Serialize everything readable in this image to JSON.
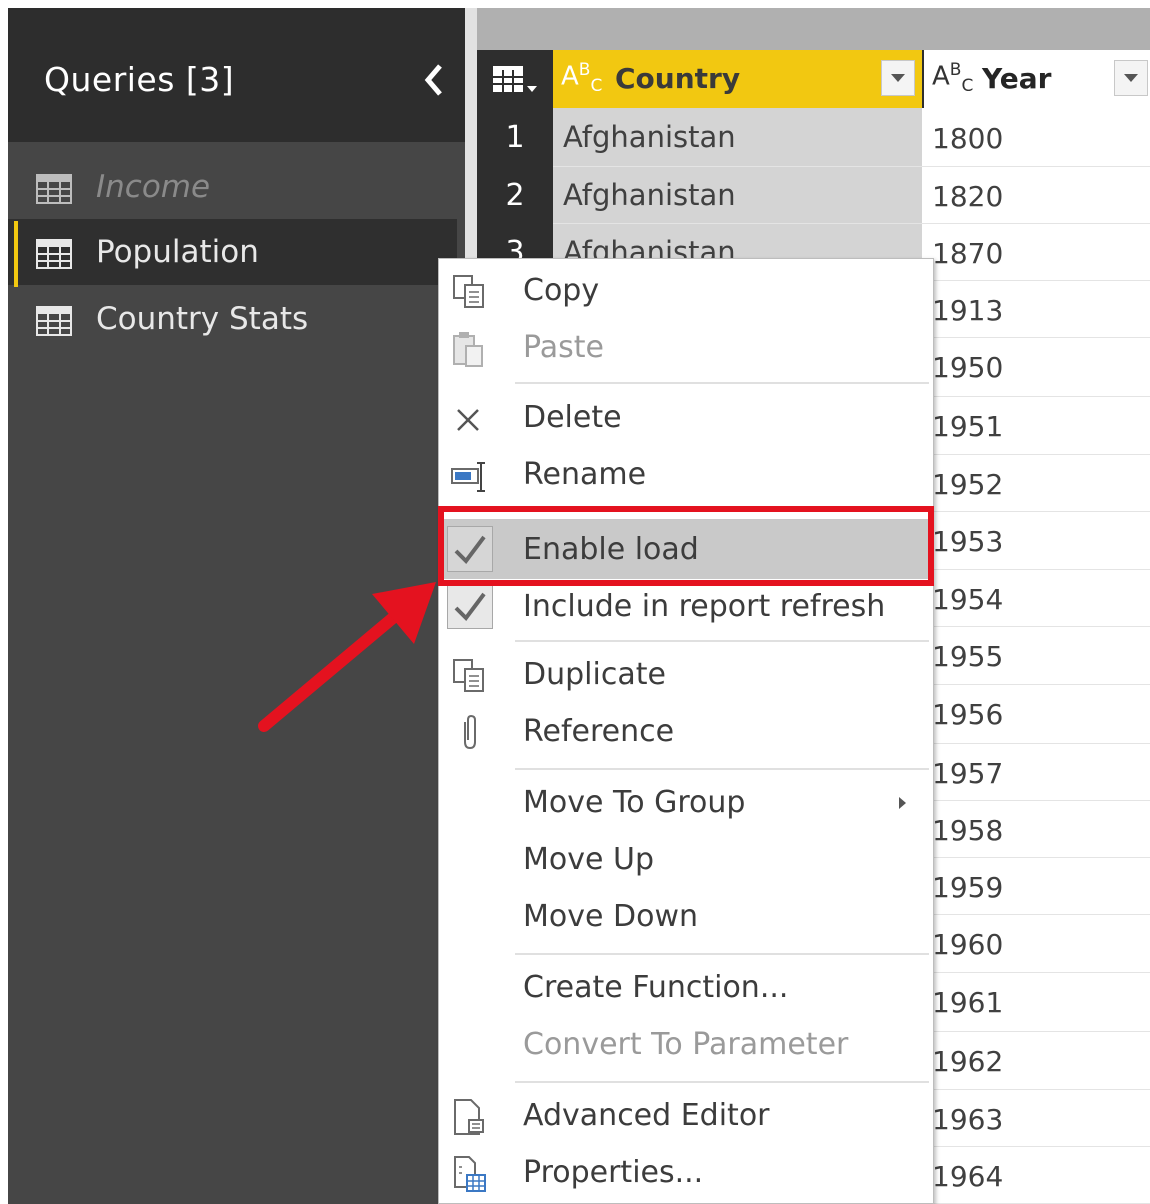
{
  "queries_pane": {
    "title": "Queries [3]",
    "collapse_glyph": "‹",
    "items": [
      {
        "label": "Income",
        "icon": "table-icon",
        "state": "disabled"
      },
      {
        "label": "Population",
        "icon": "table-icon",
        "state": "selected"
      },
      {
        "label": "Country Stats",
        "icon": "table-icon",
        "state": "normal"
      }
    ]
  },
  "grid": {
    "columns": [
      {
        "name": "Country",
        "type_icon": "ABC",
        "selected": true
      },
      {
        "name": "Year",
        "type_icon": "ABC",
        "selected": false
      }
    ],
    "row_numbers": [
      "1",
      "2",
      "3"
    ],
    "country_values": [
      "Afghanistan",
      "Afghanistan",
      "Afghanistan"
    ],
    "year_values": [
      "1800",
      "1820",
      "1870",
      "1913",
      "1950",
      "1951",
      "1952",
      "1953",
      "1954",
      "1955",
      "1956",
      "1957",
      "1958",
      "1959",
      "1960",
      "1961",
      "1962",
      "1963",
      "1964"
    ]
  },
  "context_menu": {
    "items": [
      {
        "label": "Copy",
        "icon": "copy-icon",
        "enabled": true
      },
      {
        "label": "Paste",
        "icon": "paste-icon",
        "enabled": false
      },
      {
        "label": "Delete",
        "icon": "delete-icon",
        "enabled": true
      },
      {
        "label": "Rename",
        "icon": "rename-icon",
        "enabled": true
      },
      {
        "label": "Enable load",
        "icon": "check-icon",
        "checked": true,
        "hovered": true,
        "highlighted": true
      },
      {
        "label": "Include in report refresh",
        "icon": "check-icon",
        "checked": true
      },
      {
        "label": "Duplicate",
        "icon": "duplicate-icon",
        "enabled": true
      },
      {
        "label": "Reference",
        "icon": "paperclip-icon",
        "enabled": true
      },
      {
        "label": "Move To Group",
        "icon": "",
        "has_submenu": true
      },
      {
        "label": "Move Up",
        "icon": ""
      },
      {
        "label": "Move Down",
        "icon": ""
      },
      {
        "label": "Create Function...",
        "icon": ""
      },
      {
        "label": "Convert To Parameter",
        "icon": "",
        "enabled": false
      },
      {
        "label": "Advanced Editor",
        "icon": "advanced-editor-icon"
      },
      {
        "label": "Properties...",
        "icon": "properties-icon"
      }
    ]
  },
  "annotation": {
    "highlight_color": "#e4121f",
    "arrow_color": "#e4121f"
  },
  "colors": {
    "accent": "#f2c811",
    "pane_bg": "#464646",
    "header_bg": "#2d2d2d"
  }
}
